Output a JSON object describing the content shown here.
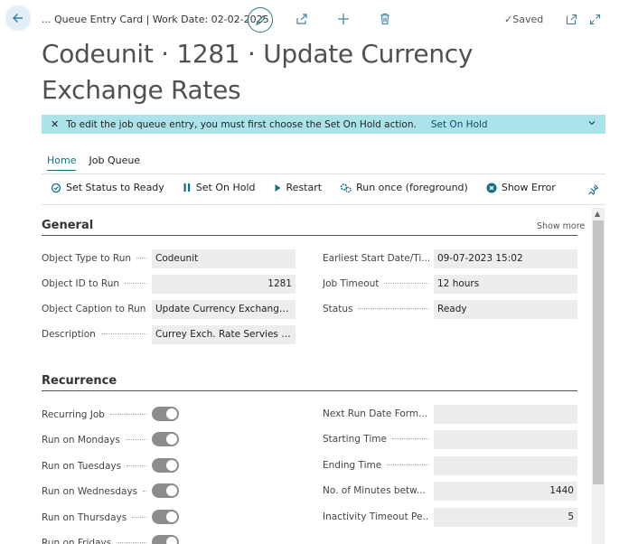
{
  "topbar": {
    "breadcrumb": "... Queue Entry Card | Work Date: 02-02-2025",
    "saved_label": "Saved"
  },
  "page": {
    "title": "Codeunit · 1281 · Update Currency Exchange Rates"
  },
  "banner": {
    "message": "To edit the job queue entry, you must first choose the Set On Hold action.",
    "action": "Set On Hold"
  },
  "tabs": [
    {
      "label": "Home",
      "active": true
    },
    {
      "label": "Job Queue",
      "active": false
    }
  ],
  "actions": {
    "set_status_ready": "Set Status to Ready",
    "set_on_hold": "Set On Hold",
    "restart": "Restart",
    "run_once": "Run once (foreground)",
    "show_error": "Show Error"
  },
  "general": {
    "title": "General",
    "show_more": "Show more",
    "left": [
      {
        "label": "Object Type to Run",
        "value": "Codeunit"
      },
      {
        "label": "Object ID to Run",
        "value": "1281"
      },
      {
        "label": "Object Caption to Run",
        "value": "Update Currency Exchange Rat..."
      },
      {
        "label": "Description",
        "value": "Currey Exch. Rate Servies - rec..."
      }
    ],
    "right": [
      {
        "label": "Earliest Start Date/Ti...",
        "value": "09-07-2023 15:02"
      },
      {
        "label": "Job Timeout",
        "value": "12 hours"
      },
      {
        "label": "Status",
        "value": "Ready"
      }
    ]
  },
  "recurrence": {
    "title": "Recurrence",
    "left": [
      {
        "label": "Recurring Job",
        "on": true
      },
      {
        "label": "Run on Mondays",
        "on": true
      },
      {
        "label": "Run on Tuesdays",
        "on": true
      },
      {
        "label": "Run on Wednesdays",
        "on": true
      },
      {
        "label": "Run on Thursdays",
        "on": true
      },
      {
        "label": "Run on Fridays",
        "on": true
      }
    ],
    "right": [
      {
        "label": "Next Run Date Form...",
        "value": ""
      },
      {
        "label": "Starting Time",
        "value": ""
      },
      {
        "label": "Ending Time",
        "value": ""
      },
      {
        "label": "No. of Minutes betw...",
        "value": "1440"
      },
      {
        "label": "Inactivity Timeout Pe...",
        "value": "5"
      }
    ]
  },
  "colors": {
    "accent": "#0e6f86",
    "banner": "#aae4ea",
    "toggle_on": "#8c8c8c"
  }
}
